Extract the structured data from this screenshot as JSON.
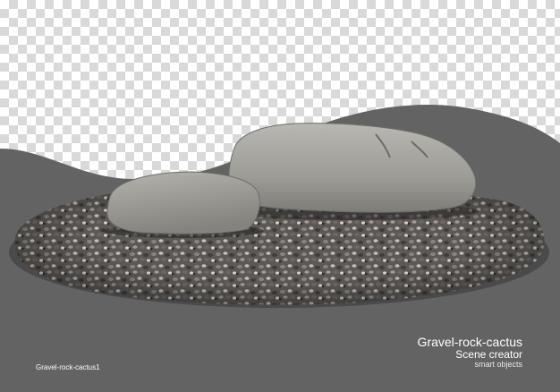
{
  "caption": {
    "title": "Gravel-rock-cactus",
    "subtitle": "Scene creator",
    "tagline": "smart objects"
  },
  "file_label": "Gravel-rock-cactus1",
  "colors": {
    "backdrop": "#636363",
    "checker_light": "#ffffff",
    "checker_dark": "#d9d9d9",
    "rock": "#a6a49e",
    "caption_text": "#ffffff"
  }
}
